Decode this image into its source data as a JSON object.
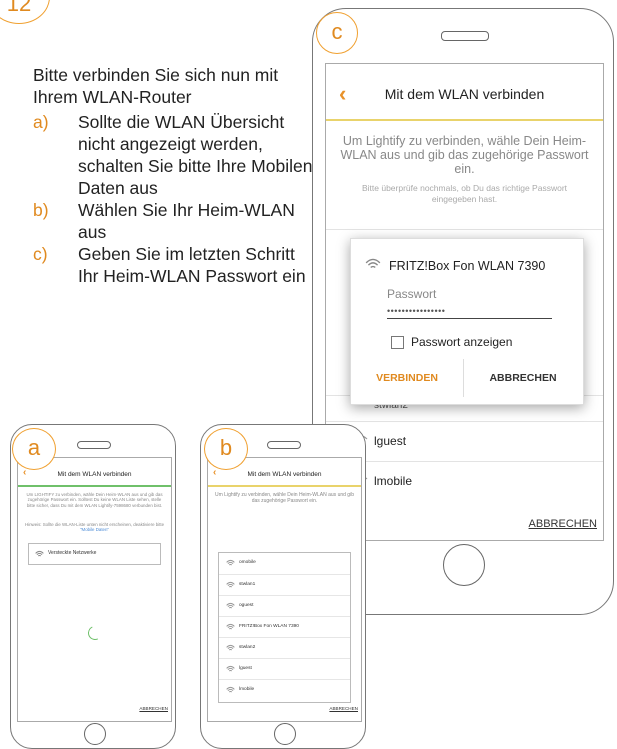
{
  "step_number": "12",
  "intro": "Bitte verbinden Sie sich nun mit Ihrem WLAN-Router",
  "steps": [
    {
      "letter": "a)",
      "text": "Sollte die WLAN Übersicht nicht angezeigt werden, schalten Sie bitte Ihre Mobilen Daten aus"
    },
    {
      "letter": "b)",
      "text": "Wählen Sie Ihr Heim-WLAN aus"
    },
    {
      "letter": "c)",
      "text": "Geben Sie im letzten Schritt Ihr Heim-WLAN Passwort ein"
    }
  ],
  "phone_c": {
    "badge": "c",
    "title": "Mit dem WLAN verbinden",
    "description": "Um Lightify zu verbinden, wähle Dein Heim-WLAN aus und gib das zugehörige Passwort ein.",
    "hint": "Bitte überprüfe nochmals, ob Du das richtige Passwort eingegeben hast.",
    "networks": [
      "omobile",
      "stwlan1",
      "oguest",
      "FRITZ!Box Fon WLAN 7390",
      "stwlan2",
      "lguest",
      "lmobile"
    ],
    "visible_networks": [
      "lguest",
      "lmobile"
    ],
    "partial_network": "stwlan2",
    "cancel": "ABBRECHEN",
    "dialog": {
      "network": "FRITZ!Box Fon WLAN 7390",
      "password_label": "Passwort",
      "password_value": "••••••••••••••••",
      "show_password": "Passwort anzeigen",
      "connect": "VERBINDEN",
      "cancel": "ABBRECHEN"
    }
  },
  "phone_a": {
    "badge": "a",
    "title": "Mit dem WLAN verbinden",
    "text1": "Um LIGHTIFY zu verbinden, wähle Dein Heim-WLAN aus und gib das zugehörige Passwort ein. Solltest Du keine WLAN Liste sehen, stelle bitte sicher, dass Du mit dem WLAN Lightify-7598680 verbunden bist.",
    "text2_prefix": "Hinweis: Sollte die WLAN-Liste unten nicht erscheinen, deaktiviere bitte ",
    "text2_link": "\"Mobile Daten\"",
    "hidden_networks": "Versteckte Netzwerke",
    "cancel": "ABBRECHEN"
  },
  "phone_b": {
    "badge": "b",
    "title": "Mit dem WLAN verbinden",
    "description": "Um Lightify zu verbinden, wähle Dein Heim-WLAN aus und gib das zugehörige Passwort ein.",
    "networks": [
      "omobile",
      "stwlan1",
      "oguest",
      "FRITZ!Box Fon WLAN 7390",
      "stwlan2",
      "lguest",
      "lmobile"
    ],
    "cancel": "ABBRECHEN"
  },
  "colors": {
    "accent": "#e08a20",
    "header_line": "#e9d36b",
    "green": "#6fc06a",
    "link": "#4a8ad6"
  },
  "icons": {
    "wifi": "wifi-icon",
    "back": "chevron-left-icon"
  }
}
